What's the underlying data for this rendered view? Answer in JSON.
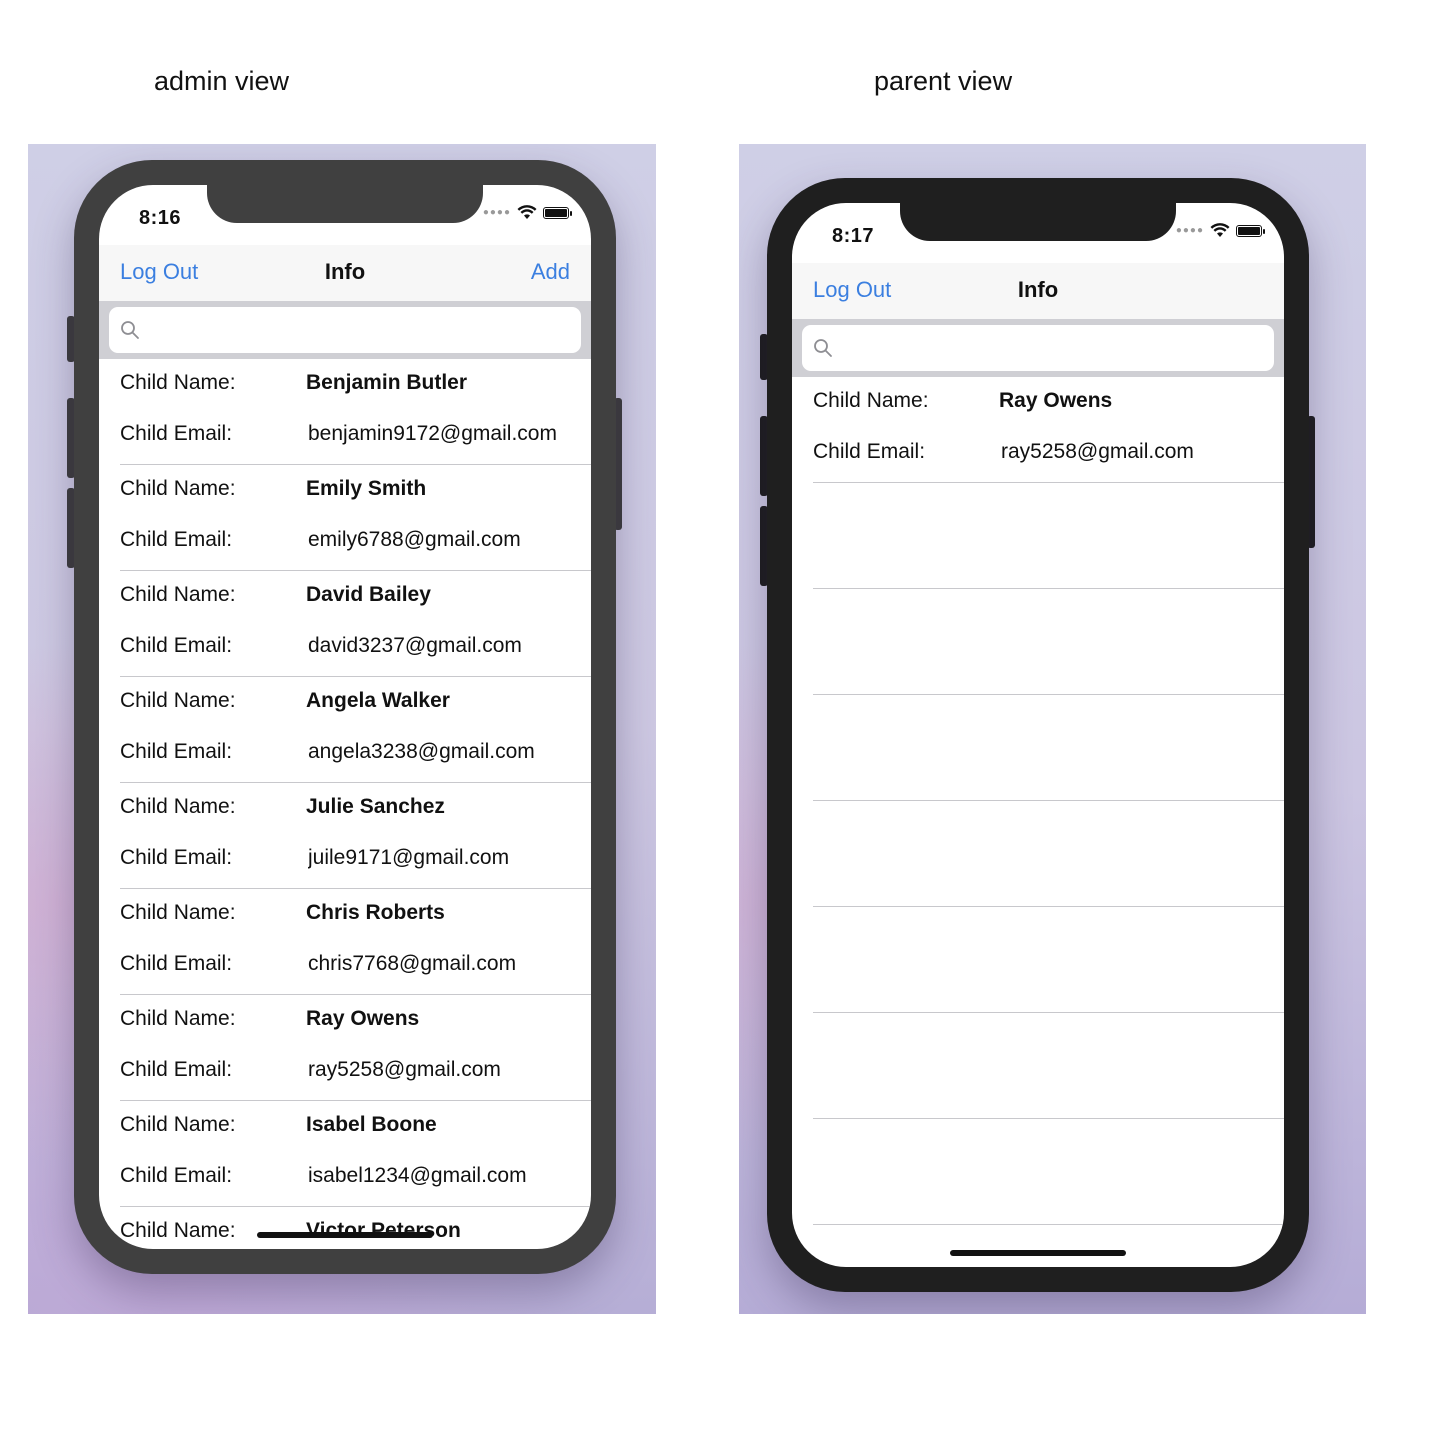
{
  "captions": {
    "admin": "admin view",
    "parent": "parent view"
  },
  "admin": {
    "status_time": "8:16",
    "nav": {
      "left": "Log Out",
      "title": "Info",
      "right": "Add"
    },
    "labels": {
      "name": "Child Name:",
      "email": "Child Email:"
    },
    "rows": [
      {
        "name": "Benjamin Butler",
        "email": "benjamin9172@gmail.com"
      },
      {
        "name": "Emily Smith",
        "email": "emily6788@gmail.com"
      },
      {
        "name": "David Bailey",
        "email": "david3237@gmail.com"
      },
      {
        "name": "Angela Walker",
        "email": "angela3238@gmail.com"
      },
      {
        "name": "Julie Sanchez",
        "email": "juile9171@gmail.com"
      },
      {
        "name": "Chris Roberts",
        "email": "chris7768@gmail.com"
      },
      {
        "name": "Ray Owens",
        "email": "ray5258@gmail.com"
      },
      {
        "name": "Isabel Boone",
        "email": "isabel1234@gmail.com"
      },
      {
        "name": "Victor Peterson"
      }
    ]
  },
  "parent": {
    "status_time": "8:17",
    "nav": {
      "left": "Log Out",
      "title": "Info"
    },
    "labels": {
      "name": "Child Name:",
      "email": "Child Email:"
    },
    "rows": [
      {
        "name": "Ray Owens",
        "email": "ray5258@gmail.com"
      }
    ]
  },
  "colors": {
    "accent": "#3b7fe0",
    "search_bg": "#cfcfd4",
    "admin_frame": "#404040",
    "parent_frame": "#1f1f1f"
  },
  "icons": [
    "search-icon",
    "wifi-icon",
    "battery-icon",
    "signal-dots-icon"
  ]
}
